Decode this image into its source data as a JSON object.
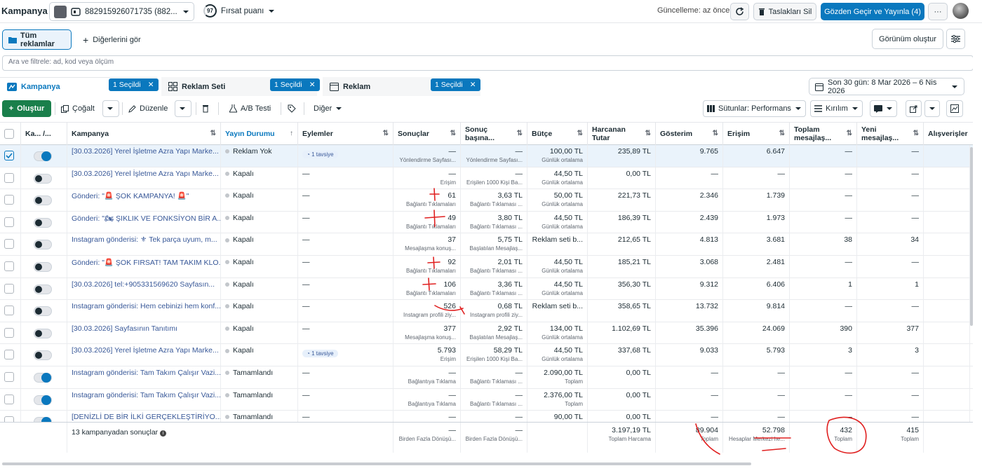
{
  "header": {
    "title": "Kampanya",
    "account_label": "882915926071735 (882...",
    "score_value": "97",
    "score_label": "Fırsat puanı",
    "updated": "Güncelleme: az önce",
    "discard_label": "Taslakları Sil",
    "publish_label": "Gözden Geçir ve Yayınla (4)",
    "more_label": "···"
  },
  "filters": {
    "all_ads": "Tüm reklamlar",
    "see_others": "Diğerlerini gör",
    "create_view": "Görünüm oluştur",
    "search_placeholder": "Ara ve filtrele: ad, kod veya ölçüm"
  },
  "level_tabs": {
    "campaign": "Kampanya",
    "campaign_chip": "1 Seçildi",
    "adset": "Reklam Seti",
    "adset_chip": "1 Seçildi",
    "ad": "Reklam",
    "ad_chip": "1 Seçildi",
    "date_range": "Son 30 gün: 8 Mar 2026 – 6 Nis 2026"
  },
  "toolbar": {
    "create": "Oluştur",
    "duplicate": "Çoğalt",
    "edit": "Düzenle",
    "ab_test": "A/B Testi",
    "other": "Diğer",
    "columns": "Sütunlar: Performans",
    "breakdown": "Kırılım"
  },
  "columns": [
    "Ka... /...",
    "Kampanya",
    "Yayın Durumu",
    "Eylemler",
    "Sonuçlar",
    "Sonuç başına...",
    "Bütçe",
    "Harcanan Tutar",
    "Gösterim",
    "Erişim",
    "Toplam mesajlaş...",
    "Yeni mesajlaş...",
    "Alışverişler"
  ],
  "rows": [
    {
      "name": "[30.03.2026] Yerel İşletme Azra Yapı Marke...",
      "status": "Reklam Yok",
      "action": "1 tavsiye",
      "results": "—",
      "results_sub": "Yönlendirme Sayfası...",
      "cpr": "—",
      "cpr_sub": "Yönlendirme Sayfası...",
      "budget": "100,00 TL",
      "budget_sub": "Günlük ortalama",
      "spent": "235,89 TL",
      "impr": "9.765",
      "reach": "6.647",
      "total_msg": "—",
      "new_msg": "—",
      "on": true,
      "selected": true
    },
    {
      "name": "[30.03.2026] Yerel İşletme Azra Yapı Marke...",
      "status": "Kapalı",
      "action": "—",
      "results": "—",
      "results_sub": "Erişim",
      "cpr": "—",
      "cpr_sub": "Erişilen 1000 Kişi Ba...",
      "budget": "44,50 TL",
      "budget_sub": "Günlük ortalama",
      "spent": "0,00 TL",
      "impr": "—",
      "reach": "—",
      "total_msg": "—",
      "new_msg": "—",
      "on": false,
      "selected": false
    },
    {
      "name": "Gönderi: \"🚨 ŞOK KAMPANYA! 🚨\"",
      "status": "Kapalı",
      "action": "—",
      "results": "61",
      "results_sub": "Bağlantı Tıklamaları",
      "cpr": "3,63 TL",
      "cpr_sub": "Bağlantı Tıklaması ...",
      "budget": "50,00 TL",
      "budget_sub": "Günlük ortalama",
      "spent": "221,73 TL",
      "impr": "2.346",
      "reach": "1.739",
      "total_msg": "—",
      "new_msg": "—",
      "on": false,
      "selected": false
    },
    {
      "name": "Gönderi: \"🏍 ŞIKLIK VE FONKSİYON BİR A...",
      "status": "Kapalı",
      "action": "—",
      "results": "49",
      "results_sub": "Bağlantı Tıklamaları",
      "cpr": "3,80 TL",
      "cpr_sub": "Bağlantı Tıklaması ...",
      "budget": "44,50 TL",
      "budget_sub": "Günlük ortalama",
      "spent": "186,39 TL",
      "impr": "2.439",
      "reach": "1.973",
      "total_msg": "—",
      "new_msg": "—",
      "on": false,
      "selected": false
    },
    {
      "name": "Instagram gönderisi: ⚜ Tek parça uyum, m...",
      "status": "Kapalı",
      "action": "—",
      "results": "37",
      "results_sub": "Mesajlaşma konuş...",
      "cpr": "5,75 TL",
      "cpr_sub": "Başlatılan Mesajlaş...",
      "budget": "Reklam seti b...",
      "budget_sub": "",
      "spent": "212,65 TL",
      "impr": "4.813",
      "reach": "3.681",
      "total_msg": "38",
      "new_msg": "34",
      "on": false,
      "selected": false
    },
    {
      "name": "Gönderi: \"🚨 ŞOK FIRSAT! TAM TAKIM KLO...",
      "status": "Kapalı",
      "action": "—",
      "results": "92",
      "results_sub": "Bağlantı Tıklamaları",
      "cpr": "2,01 TL",
      "cpr_sub": "Bağlantı Tıklaması ...",
      "budget": "44,50 TL",
      "budget_sub": "Günlük ortalama",
      "spent": "185,21 TL",
      "impr": "3.068",
      "reach": "2.481",
      "total_msg": "—",
      "new_msg": "—",
      "on": false,
      "selected": false
    },
    {
      "name": "[30.03.2026] tel:+905331569620 Sayfasın...",
      "status": "Kapalı",
      "action": "—",
      "results": "106",
      "results_sub": "Bağlantı Tıklamaları",
      "cpr": "3,36 TL",
      "cpr_sub": "Bağlantı Tıklaması ...",
      "budget": "44,50 TL",
      "budget_sub": "Günlük ortalama",
      "spent": "356,30 TL",
      "impr": "9.312",
      "reach": "6.406",
      "total_msg": "1",
      "new_msg": "1",
      "on": false,
      "selected": false
    },
    {
      "name": "Instagram gönderisi: Hem cebinizi hem konf...",
      "status": "Kapalı",
      "action": "—",
      "results": "526",
      "results_sub": "Instagram profili ziy...",
      "cpr": "0,68 TL",
      "cpr_sub": "Instagram profili ziy...",
      "budget": "Reklam seti b...",
      "budget_sub": "",
      "spent": "358,65 TL",
      "impr": "13.732",
      "reach": "9.814",
      "total_msg": "—",
      "new_msg": "—",
      "on": false,
      "selected": false
    },
    {
      "name": "[30.03.2026] Sayfasının Tanıtımı",
      "status": "Kapalı",
      "action": "—",
      "results": "377",
      "results_sub": "Mesajlaşma konuş...",
      "cpr": "2,92 TL",
      "cpr_sub": "Başlatılan Mesajlaş...",
      "budget": "134,00 TL",
      "budget_sub": "Günlük ortalama",
      "spent": "1.102,69 TL",
      "impr": "35.396",
      "reach": "24.069",
      "total_msg": "390",
      "new_msg": "377",
      "on": false,
      "selected": false
    },
    {
      "name": "[30.03.2026] Yerel İşletme Azra Yapı Marke...",
      "status": "Kapalı",
      "action": "1 tavsiye",
      "results": "5.793",
      "results_sub": "Erişim",
      "cpr": "58,29 TL",
      "cpr_sub": "Erişilen 1000 Kişi Ba...",
      "budget": "44,50 TL",
      "budget_sub": "Günlük ortalama",
      "spent": "337,68 TL",
      "impr": "9.033",
      "reach": "5.793",
      "total_msg": "3",
      "new_msg": "3",
      "on": false,
      "selected": false
    },
    {
      "name": "Instagram gönderisi: Tam Takım Çalışır Vazi...",
      "status": "Tamamlandı",
      "action": "—",
      "results": "—",
      "results_sub": "Bağlantıya Tıklama",
      "cpr": "—",
      "cpr_sub": "Bağlantı Tıklaması ...",
      "budget": "2.090,00 TL",
      "budget_sub": "Toplam",
      "spent": "0,00 TL",
      "impr": "—",
      "reach": "—",
      "total_msg": "—",
      "new_msg": "—",
      "on": true,
      "selected": false
    },
    {
      "name": "Instagram gönderisi: Tam Takım Çalışır Vazi...",
      "status": "Tamamlandı",
      "action": "—",
      "results": "—",
      "results_sub": "Bağlantıya Tıklama",
      "cpr": "—",
      "cpr_sub": "Bağlantı Tıklaması ...",
      "budget": "2.376,00 TL",
      "budget_sub": "Toplam",
      "spent": "0,00 TL",
      "impr": "—",
      "reach": "—",
      "total_msg": "—",
      "new_msg": "—",
      "on": true,
      "selected": false
    },
    {
      "name": "[DENİZLİ DE BİR İLKİ GERÇEKLEŞTİRİYO...",
      "status": "Tamamlandı",
      "action": "—",
      "results": "—",
      "results_sub": "",
      "cpr": "—",
      "cpr_sub": "",
      "budget": "90,00 TL",
      "budget_sub": "",
      "spent": "0,00 TL",
      "impr": "—",
      "reach": "—",
      "total_msg": "—",
      "new_msg": "—",
      "on": true,
      "selected": false
    }
  ],
  "footer": {
    "summary": "13 kampanyadan sonuçlar",
    "results": "—",
    "results_sub": "Birden Fazla Dönüşü...",
    "cpr": "—",
    "cpr_sub": "Birden Fazla Dönüşü...",
    "spent": "3.197,19 TL",
    "spent_sub": "Toplam Harcama",
    "impr": "89.904",
    "impr_sub": "Toplam",
    "reach": "52.798",
    "reach_sub": "Hesaplar Merkezi he...",
    "total_msg": "432",
    "total_msg_sub": "Toplam",
    "new_msg": "415",
    "new_msg_sub": "Toplam"
  },
  "colors": {
    "accent": "#0a78be",
    "create": "#1a7f4b",
    "annotation": "#e02020"
  }
}
